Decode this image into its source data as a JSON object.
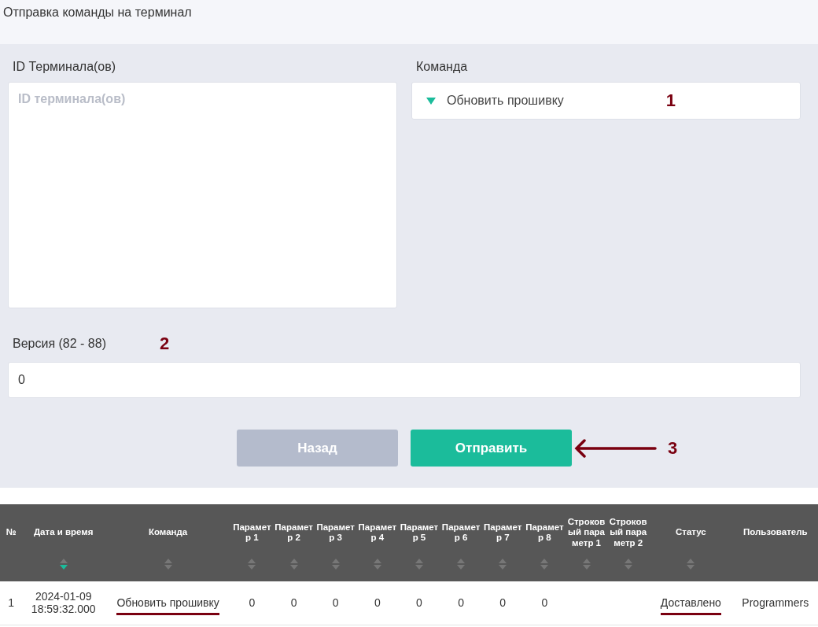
{
  "page_title": "Отправка команды на терминал",
  "form": {
    "terminals": {
      "label": "ID Терминала(ов)",
      "placeholder": "ID терминала(ов)"
    },
    "command": {
      "label": "Команда",
      "value": "Обновить прошивку"
    },
    "version": {
      "label": "Версия (82 - 88)",
      "value": "0"
    },
    "buttons": [
      {
        "label": "Назад",
        "kind": "secondary"
      },
      {
        "label": "Отправить",
        "kind": "primary"
      }
    ]
  },
  "annotations": [
    "1",
    "2",
    "3"
  ],
  "table": {
    "columns": [
      {
        "label": "№",
        "sortable": false,
        "sorted": false
      },
      {
        "label": "Дата и время",
        "sortable": true,
        "sorted": true
      },
      {
        "label": "Команда",
        "sortable": true,
        "sorted": false
      },
      {
        "label": "Парамет р 1",
        "sortable": true,
        "sorted": false
      },
      {
        "label": "Парамет р 2",
        "sortable": true,
        "sorted": false
      },
      {
        "label": "Парамет р 3",
        "sortable": true,
        "sorted": false
      },
      {
        "label": "Парамет р 4",
        "sortable": true,
        "sorted": false
      },
      {
        "label": "Парамет р 5",
        "sortable": true,
        "sorted": false
      },
      {
        "label": "Парамет р 6",
        "sortable": true,
        "sorted": false
      },
      {
        "label": "Парамет р 7",
        "sortable": true,
        "sorted": false
      },
      {
        "label": "Парамет р 8",
        "sortable": true,
        "sorted": false
      },
      {
        "label": "Строков ый пара метр 1",
        "sortable": true,
        "sorted": false
      },
      {
        "label": "Строков ый пара метр 2",
        "sortable": true,
        "sorted": false
      },
      {
        "label": "Статус",
        "sortable": true,
        "sorted": false
      },
      {
        "label": "Пользователь",
        "sortable": false,
        "sorted": false
      }
    ],
    "rows": [
      {
        "cells": [
          {
            "text": "1",
            "underlined": false
          },
          {
            "text": "2024-01-09 18:59:32.000",
            "underlined": false
          },
          {
            "text": "Обновить прошивку",
            "underlined": true
          },
          {
            "text": "0",
            "underlined": false
          },
          {
            "text": "0",
            "underlined": false
          },
          {
            "text": "0",
            "underlined": false
          },
          {
            "text": "0",
            "underlined": false
          },
          {
            "text": "0",
            "underlined": false
          },
          {
            "text": "0",
            "underlined": false
          },
          {
            "text": "0",
            "underlined": false
          },
          {
            "text": "0",
            "underlined": false
          },
          {
            "underlined": false
          },
          {
            "underlined": false
          },
          {
            "text": "Доставлено",
            "underlined": true
          },
          {
            "text": "Programmers",
            "underlined": false
          }
        ]
      }
    ]
  }
}
